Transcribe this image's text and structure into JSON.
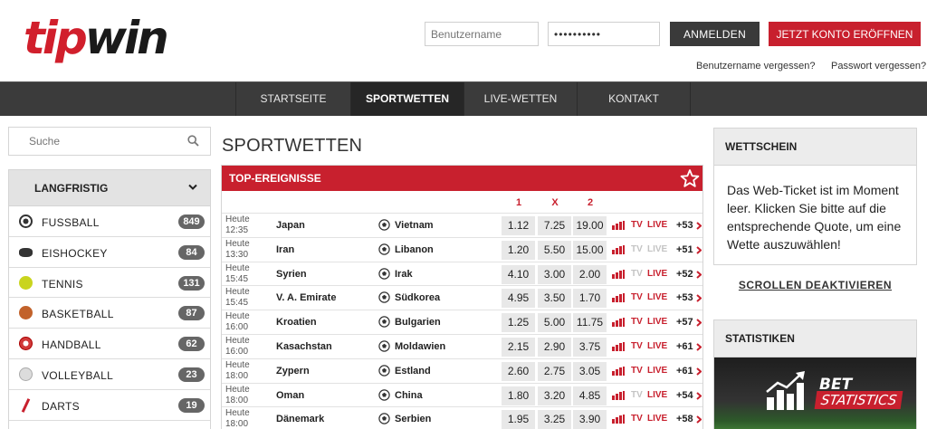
{
  "colors": {
    "brand_red": "#c8202e",
    "nav_bg": "#3b3b3b",
    "nav_active": "#262626",
    "badge": "#666666"
  },
  "logo": {
    "part1": "tip",
    "part2": "win"
  },
  "login": {
    "username_placeholder": "Benutzername",
    "password_value": "••••••••••",
    "login_button": "ANMELDEN",
    "register_button": "JETZT KONTO ERÖFFNEN",
    "forgot_username": "Benutzername vergessen?",
    "forgot_password": "Passwort vergessen?"
  },
  "nav": {
    "items": [
      {
        "label": "STARTSEITE",
        "active": false
      },
      {
        "label": "SPORTWETTEN",
        "active": true
      },
      {
        "label": "LIVE-WETTEN",
        "active": false
      },
      {
        "label": "KONTAKT",
        "active": false
      }
    ]
  },
  "search": {
    "placeholder": "Suche",
    "icon": "search-icon"
  },
  "sidebar": {
    "header": "LANGFRISTIG",
    "sports": [
      {
        "label": "FUSSBALL",
        "count": "849",
        "icon": "football-icon",
        "color": "#ffffff"
      },
      {
        "label": "EISHOCKEY",
        "count": "84",
        "icon": "puck-icon",
        "color": "#333333"
      },
      {
        "label": "TENNIS",
        "count": "131",
        "icon": "tennis-ball-icon",
        "color": "#c9d41e"
      },
      {
        "label": "BASKETBALL",
        "count": "87",
        "icon": "basketball-icon",
        "color": "#c2622b"
      },
      {
        "label": "HANDBALL",
        "count": "62",
        "icon": "handball-icon",
        "color": "#d13a3a"
      },
      {
        "label": "VOLLEYBALL",
        "count": "23",
        "icon": "volleyball-icon",
        "color": "#dcdcdc"
      },
      {
        "label": "DARTS",
        "count": "19",
        "icon": "dart-icon",
        "color": "#c8202e"
      }
    ]
  },
  "main": {
    "title": "SPORTWETTEN",
    "top_events": {
      "label": "TOP-EREIGNISSE",
      "odds_headers": [
        "1",
        "X",
        "2"
      ],
      "rows": [
        {
          "day": "Heute",
          "time": "12:35",
          "home": "Japan",
          "away": "Vietnam",
          "odds": [
            "1.12",
            "7.25",
            "19.00"
          ],
          "tv": true,
          "live": true,
          "more": "+53"
        },
        {
          "day": "Heute",
          "time": "13:30",
          "home": "Iran",
          "away": "Libanon",
          "odds": [
            "1.20",
            "5.50",
            "15.00"
          ],
          "tv": false,
          "live": false,
          "more": "+51"
        },
        {
          "day": "Heute",
          "time": "15:45",
          "home": "Syrien",
          "away": "Irak",
          "odds": [
            "4.10",
            "3.00",
            "2.00"
          ],
          "tv": false,
          "live": true,
          "more": "+52"
        },
        {
          "day": "Heute",
          "time": "15:45",
          "home": "V. A. Emirate",
          "away": "Südkorea",
          "odds": [
            "4.95",
            "3.50",
            "1.70"
          ],
          "tv": true,
          "live": true,
          "more": "+53"
        },
        {
          "day": "Heute",
          "time": "16:00",
          "home": "Kroatien",
          "away": "Bulgarien",
          "odds": [
            "1.25",
            "5.00",
            "11.75"
          ],
          "tv": true,
          "live": true,
          "more": "+57"
        },
        {
          "day": "Heute",
          "time": "16:00",
          "home": "Kasachstan",
          "away": "Moldawien",
          "odds": [
            "2.15",
            "2.90",
            "3.75"
          ],
          "tv": true,
          "live": true,
          "more": "+61"
        },
        {
          "day": "Heute",
          "time": "18:00",
          "home": "Zypern",
          "away": "Estland",
          "odds": [
            "2.60",
            "2.75",
            "3.05"
          ],
          "tv": true,
          "live": true,
          "more": "+61"
        },
        {
          "day": "Heute",
          "time": "18:00",
          "home": "Oman",
          "away": "China",
          "odds": [
            "1.80",
            "3.20",
            "4.85"
          ],
          "tv": false,
          "live": true,
          "more": "+54"
        },
        {
          "day": "Heute",
          "time": "18:00",
          "home": "Dänemark",
          "away": "Serbien",
          "odds": [
            "1.95",
            "3.25",
            "3.90"
          ],
          "tv": true,
          "live": true,
          "more": "+58"
        }
      ]
    }
  },
  "betslip": {
    "title": "WETTSCHEIN",
    "text": "Das Web-Ticket ist im Moment leer. Klicken Sie bitte auf die entsprechende Quote, um eine Wette auszuwählen!",
    "scroll_toggle": "SCROLLEN DEAKTIVIEREN"
  },
  "stats": {
    "title": "STATISTIKEN",
    "banner_line1": "BET",
    "banner_line2": "STATISTICS"
  },
  "labels": {
    "tv": "TV",
    "live": "LIVE"
  }
}
